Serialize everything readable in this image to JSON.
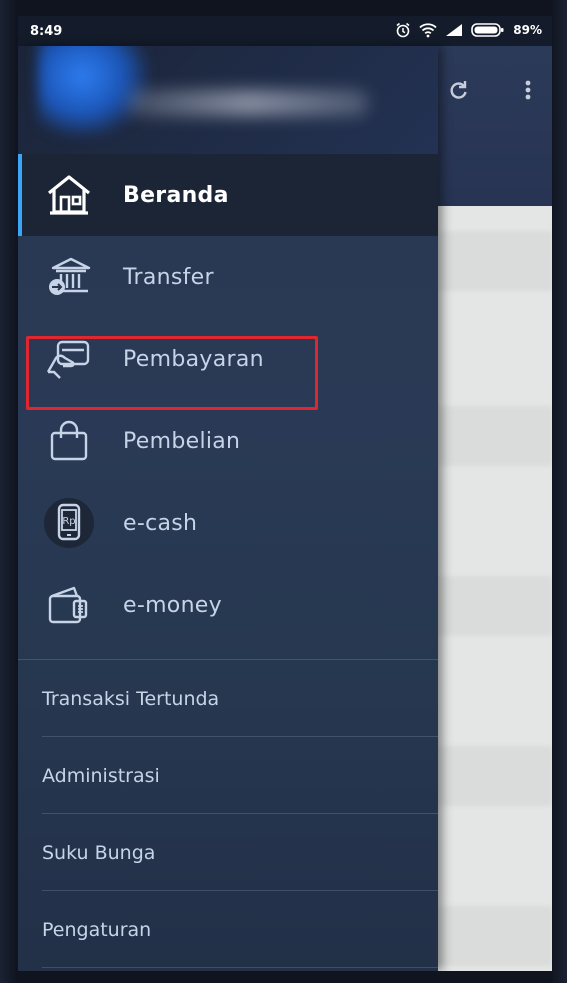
{
  "status_bar": {
    "time": "8:49",
    "battery_percent": "89%",
    "icons": [
      "alarm-icon",
      "wifi-icon",
      "signal-icon",
      "battery-icon"
    ]
  },
  "background_app": {
    "actions": [
      "refresh-icon",
      "more-vert-icon"
    ]
  },
  "drawer": {
    "header": {
      "avatar": "profile-avatar-blurred",
      "name": ""
    },
    "menu_items": [
      {
        "label": "Beranda",
        "icon": "home-icon",
        "active": true
      },
      {
        "label": "Transfer",
        "icon": "bank-transfer-icon",
        "active": false
      },
      {
        "label": "Pembayaran",
        "icon": "payment-card-icon",
        "active": false,
        "highlighted": true
      },
      {
        "label": "Pembelian",
        "icon": "shopping-bag-icon",
        "active": false
      },
      {
        "label": "e-cash",
        "icon": "phone-rp-icon",
        "active": false
      },
      {
        "label": "e-money",
        "icon": "wallet-icon",
        "active": false
      }
    ],
    "secondary_items": [
      {
        "label": "Transaksi Tertunda"
      },
      {
        "label": "Administrasi"
      },
      {
        "label": "Suku Bunga"
      },
      {
        "label": "Pengaturan"
      }
    ]
  },
  "colors": {
    "drawer_bg": "#28374f",
    "active_accent": "#3aa6f5",
    "highlight_border": "#e0262f",
    "text": "#c7d3e6"
  }
}
